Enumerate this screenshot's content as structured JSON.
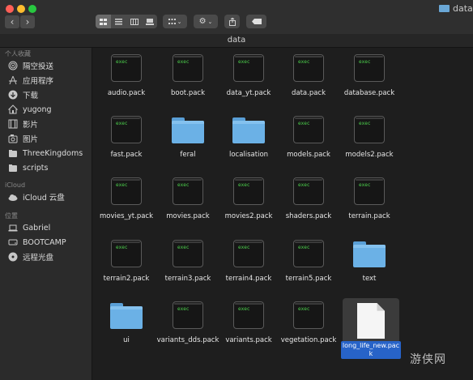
{
  "window": {
    "title": "data"
  },
  "path_bar": {
    "title": "data"
  },
  "sidebar": {
    "favorites_heading": "个人收藏",
    "favorites": [
      {
        "label": "隔空投送",
        "icon": "airdrop-icon"
      },
      {
        "label": "应用程序",
        "icon": "applications-icon"
      },
      {
        "label": "下载",
        "icon": "downloads-icon"
      },
      {
        "label": "yugong",
        "icon": "home-icon"
      },
      {
        "label": "影片",
        "icon": "movies-icon"
      },
      {
        "label": "图片",
        "icon": "pictures-icon"
      },
      {
        "label": "ThreeKingdoms",
        "icon": "folder-icon"
      },
      {
        "label": "scripts",
        "icon": "folder-icon"
      }
    ],
    "icloud_heading": "iCloud",
    "icloud": [
      {
        "label": "iCloud 云盘",
        "icon": "icloud-icon"
      }
    ],
    "locations_heading": "位置",
    "locations": [
      {
        "label": "Gabriel",
        "icon": "laptop-icon"
      },
      {
        "label": "BOOTCAMP",
        "icon": "disk-icon"
      },
      {
        "label": "远程光盘",
        "icon": "optical-disc-icon"
      }
    ]
  },
  "exec_label": "exec",
  "files": [
    {
      "name": "audio.pack",
      "kind": "exec"
    },
    {
      "name": "boot.pack",
      "kind": "exec"
    },
    {
      "name": "data_yt.pack",
      "kind": "exec"
    },
    {
      "name": "data.pack",
      "kind": "exec"
    },
    {
      "name": "database.pack",
      "kind": "exec"
    },
    {
      "name": "fast.pack",
      "kind": "exec"
    },
    {
      "name": "feral",
      "kind": "folder"
    },
    {
      "name": "localisation",
      "kind": "folder"
    },
    {
      "name": "models.pack",
      "kind": "exec"
    },
    {
      "name": "models2.pack",
      "kind": "exec"
    },
    {
      "name": "movies_yt.pack",
      "kind": "exec"
    },
    {
      "name": "movies.pack",
      "kind": "exec"
    },
    {
      "name": "movies2.pack",
      "kind": "exec"
    },
    {
      "name": "shaders.pack",
      "kind": "exec"
    },
    {
      "name": "terrain.pack",
      "kind": "exec"
    },
    {
      "name": "terrain2.pack",
      "kind": "exec"
    },
    {
      "name": "terrain3.pack",
      "kind": "exec"
    },
    {
      "name": "terrain4.pack",
      "kind": "exec"
    },
    {
      "name": "terrain5.pack",
      "kind": "exec"
    },
    {
      "name": "text",
      "kind": "folder"
    },
    {
      "name": "ui",
      "kind": "folder"
    },
    {
      "name": "variants_dds.pack",
      "kind": "exec"
    },
    {
      "name": "variants.pack",
      "kind": "exec"
    },
    {
      "name": "vegetation.pack",
      "kind": "exec"
    },
    {
      "name": "long_life_new.pack",
      "kind": "document",
      "selected": true
    }
  ],
  "watermark": "游侠网"
}
